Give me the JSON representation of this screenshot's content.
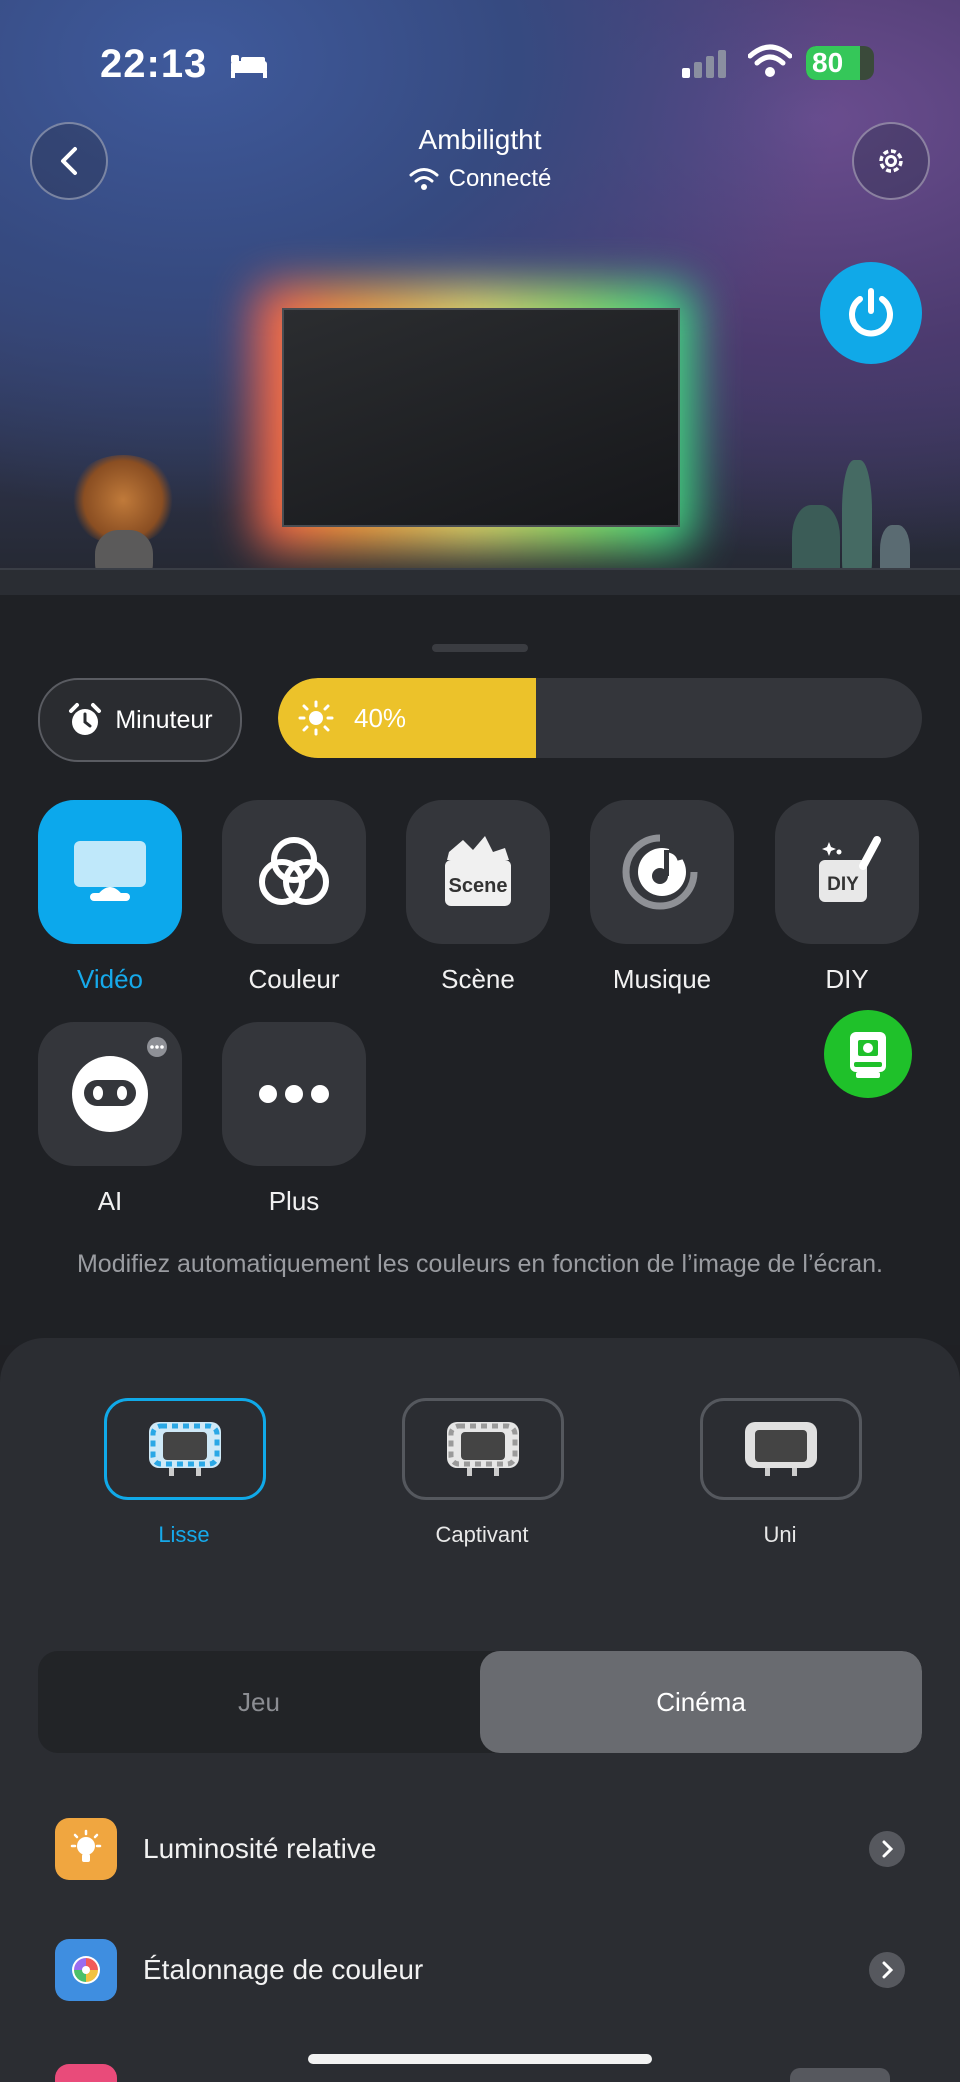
{
  "status_bar": {
    "time": "22:13",
    "battery": "80"
  },
  "header": {
    "title": "Ambiligtht",
    "connection": "Connecté"
  },
  "timer": {
    "label": "Minuteur"
  },
  "brightness": {
    "value": 40,
    "label": "40%"
  },
  "modes": [
    {
      "label": "Vidéo",
      "active": true
    },
    {
      "label": "Couleur"
    },
    {
      "label": "Scène",
      "tile_text": "Scene"
    },
    {
      "label": "Musique"
    },
    {
      "label": "DIY",
      "tile_text": "DIY"
    },
    {
      "label": "AI"
    },
    {
      "label": "Plus"
    }
  ],
  "description": "Modifiez automatiquement les couleurs en fonction de l’image de l’écran.",
  "styles": [
    {
      "label": "Lisse",
      "active": true
    },
    {
      "label": "Captivant"
    },
    {
      "label": "Uni"
    }
  ],
  "segment": {
    "left": "Jeu",
    "right": "Cinéma",
    "selected": "Cinéma"
  },
  "settings": [
    {
      "label": "Luminosité relative",
      "icon": "bulb-icon",
      "color": "#f0a640"
    },
    {
      "label": "Étalonnage de couleur",
      "icon": "color-wheel-icon",
      "color": "#3f8ee0"
    }
  ],
  "colors": {
    "accent": "#10a9e8",
    "brightness_fill": "#ecc22a",
    "green_fab": "#1fc12a"
  }
}
